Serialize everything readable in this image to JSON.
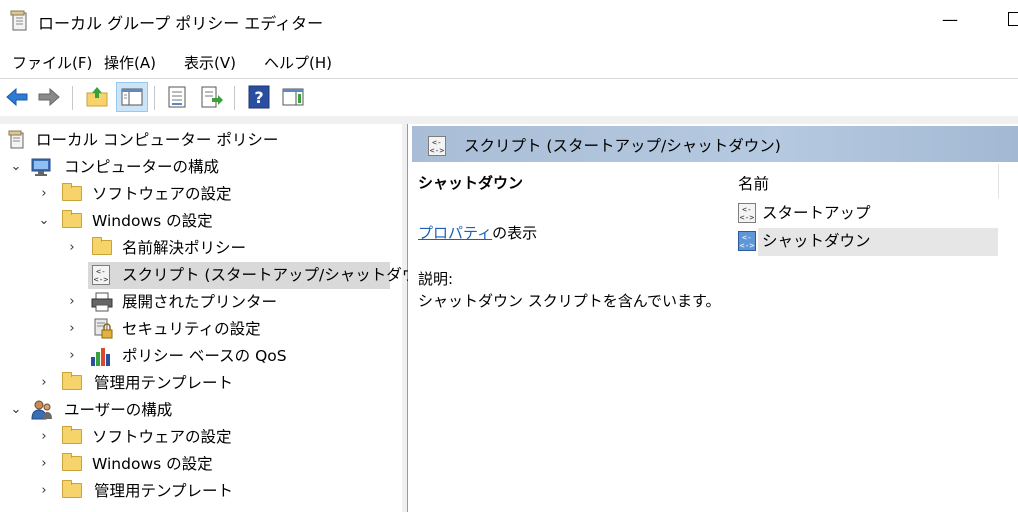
{
  "window": {
    "title": "ローカル グループ ポリシー エディター",
    "minimize_glyph": "—"
  },
  "menu": {
    "items": [
      "ファイル(F)",
      "操作(A)",
      "表示(V)",
      "ヘルプ(H)"
    ]
  },
  "toolbar": {
    "buttons": [
      "back-arrow-icon",
      "forward-arrow-icon",
      "up-folder-icon",
      "show-hide-tree-icon",
      "properties-icon",
      "export-list-icon",
      "help-icon",
      "show-action-pane-icon"
    ]
  },
  "tree": {
    "root": "ローカル コンピューター ポリシー",
    "computer_config": "コンピューターの構成",
    "software_settings": "ソフトウェアの設定",
    "windows_settings": "Windows の設定",
    "name_resolution_policy": "名前解決ポリシー",
    "scripts": "スクリプト (スタートアップ/シャットダウン)",
    "deployed_printers": "展開されたプリンター",
    "security_settings": "セキュリティの設定",
    "qos": "ポリシー ベースの QoS",
    "admin_templates": "管理用テンプレート",
    "user_config": "ユーザーの構成",
    "user_software_settings": "ソフトウェアの設定",
    "user_windows_settings": "Windows の設定",
    "user_admin_templates": "管理用テンプレート"
  },
  "right": {
    "header_title": "スクリプト (スタートアップ/シャットダウン)",
    "selected_name": "シャットダウン",
    "properties_link": "プロパティ",
    "properties_suffix": "の表示",
    "description_label": "説明:",
    "description_text": "シャットダウン スクリプトを含んでいます。",
    "column_name": "名前",
    "items": [
      "スタートアップ",
      "シャットダウン"
    ]
  },
  "colors": {
    "header_bg": "#b5c9e0",
    "selection_bg": "#d9d9d9",
    "link": "#1a5fb4",
    "folder": "#f6d36b"
  }
}
